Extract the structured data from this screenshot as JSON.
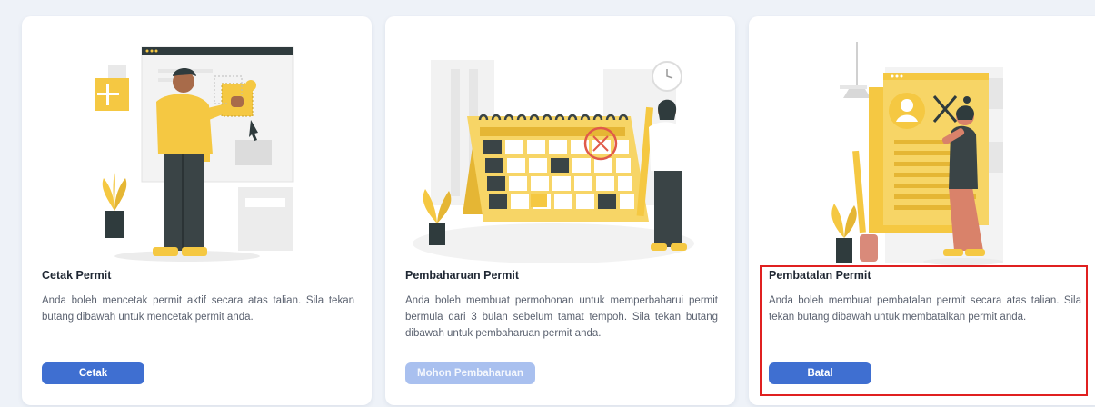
{
  "cards": [
    {
      "title": "Cetak Permit",
      "description": "Anda boleh mencetak permit aktif secara atas talian. Sila tekan butang dibawah untuk mencetak permit anda.",
      "button_label": "Cetak",
      "button_state": "enabled",
      "illustration_icon": "person-printing-document-illustration"
    },
    {
      "title": "Pembaharuan Permit",
      "description": "Anda boleh membuat permohonan untuk memperbaharui permit bermula dari 3 bulan sebelum tamat tempoh. Sila tekan butang dibawah untuk pembaharuan permit anda.",
      "button_label": "Mohon Pembaharuan",
      "button_state": "disabled",
      "illustration_icon": "calendar-renewal-illustration"
    },
    {
      "title": "Pembatalan Permit",
      "description": "Anda boleh membuat pembatalan permit secara atas talian. Sila tekan butang dibawah untuk membatalkan permit anda.",
      "button_label": "Batal",
      "button_state": "enabled",
      "illustration_icon": "cancel-document-illustration"
    }
  ],
  "colors": {
    "primary_button": "#3f6fd1",
    "disabled_button": "#a9c0ef",
    "illustration_accent": "#f5c842",
    "highlight_border": "#e02020"
  }
}
